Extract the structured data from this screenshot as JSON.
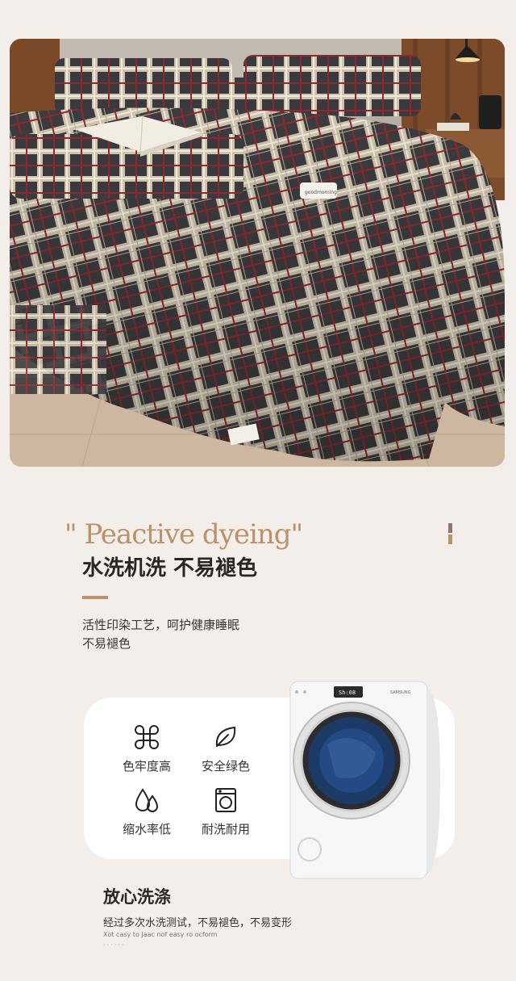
{
  "hero_image": {
    "alt": "Plaid duvet bedding set",
    "mug_text": "goodmorning",
    "colors": {
      "plaid_dark": "#3c3c40",
      "plaid_light": "#d9cfbd",
      "plaid_red": "#8e2a2e",
      "wall": "#b8b0a8",
      "wood": "#7a4a28",
      "floor": "#cfb9a2"
    }
  },
  "section": {
    "heading_en": "\" Peactive dyeing\"",
    "heading_cn": "水洗机洗 不易褪色",
    "desc_lines": [
      "活性印染工艺，呵护健康睡眠",
      "不易褪色"
    ],
    "accent_color": "#b9926a"
  },
  "features": [
    {
      "icon": "colorfast-icon",
      "label": "色牢度高"
    },
    {
      "icon": "leaf-icon",
      "label": "安全绿色"
    },
    {
      "icon": "water-drop-icon",
      "label": "缩水率低"
    },
    {
      "icon": "washing-machine-icon",
      "label": "耐洗耐用"
    }
  ],
  "washer_image": {
    "display_text": "Sh:08",
    "brand_text": "SAMSUNG"
  },
  "bottom": {
    "title": "放心洗涤",
    "desc": "经过多次水洗测试，不易褪色，不易变形",
    "desc_en": "Xot casy to Jaac nof easy ro ocform",
    "dots": "······"
  }
}
